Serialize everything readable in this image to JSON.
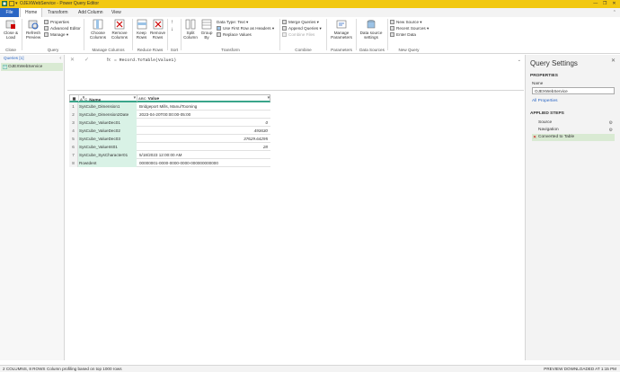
{
  "window": {
    "title": "OJEXWebService - Power Query Editor",
    "controls": [
      "—",
      "❐",
      "✕"
    ]
  },
  "tabs": [
    "File",
    "Home",
    "Transform",
    "Add Column",
    "View"
  ],
  "ribbon": {
    "close_load": "Close &\nLoad",
    "refresh_preview": "Refresh\nPreview",
    "properties": "Properties",
    "advanced_editor": "Advanced Editor",
    "manage": "Manage",
    "choose_columns": "Choose\nColumns",
    "remove_columns": "Remove\nColumns",
    "keep_rows": "Keep\nRows",
    "remove_rows": "Remove\nRows",
    "split_column": "Split\nColumn",
    "group_by": "Group\nBy",
    "data_type": "Data Type: Text",
    "use_first_row": "Use First Row as Headers",
    "replace_values": "Replace Values",
    "merge_queries": "Merge Queries",
    "append_queries": "Append Queries",
    "combine_files": "Combine Files",
    "manage_parameters": "Manage\nParameters",
    "data_source_settings": "Data source\nsettings",
    "new_source": "New Source",
    "recent_sources": "Recent Sources",
    "enter_data": "Enter Data",
    "groups": [
      "Close",
      "Query",
      "Manage Columns",
      "Reduce Rows",
      "Sort",
      "Transform",
      "Combine",
      "Parameters",
      "Data Sources",
      "New Query"
    ]
  },
  "queries": {
    "header": "Queries [1]",
    "items": [
      "OJEXWebService"
    ]
  },
  "formula": {
    "fx": "fx",
    "text": "= Record.ToTable(Value1)"
  },
  "table": {
    "columns": [
      "Name",
      "Value"
    ],
    "rows": [
      {
        "n": "1",
        "name": "SysCube_Dimension1",
        "value": "Bridgeport Mills, Manu/Tooming",
        "numeric": false
      },
      {
        "n": "2",
        "name": "SysCube_Dimension2Date",
        "value": "2023-04-20T00:00:00-05:00",
        "numeric": false
      },
      {
        "n": "3",
        "name": "SysCube_ValueDec01",
        "value": "0",
        "numeric": true
      },
      {
        "n": "4",
        "name": "SysCube_ValueDec02",
        "value": "493630",
        "numeric": true
      },
      {
        "n": "5",
        "name": "SysCube_ValueDec03",
        "value": "37629.64295",
        "numeric": true
      },
      {
        "n": "6",
        "name": "SysCube_ValueInt01",
        "value": "28",
        "numeric": true
      },
      {
        "n": "7",
        "name": "SysCube_SysCharacter01",
        "value": "5/18/2023 12:00:00 AM",
        "numeric": false
      },
      {
        "n": "8",
        "name": "RowIdent",
        "value": "00000001-0000-0000-0000-000000000000",
        "numeric": false
      }
    ]
  },
  "settings": {
    "title": "Query Settings",
    "properties_header": "PROPERTIES",
    "name_label": "Name",
    "name_value": "OJEXWebService",
    "all_properties": "All Properties",
    "applied_steps_header": "APPLIED STEPS",
    "steps": [
      "Source",
      "Navigation",
      "Converted to Table"
    ]
  },
  "status": {
    "left": "2 COLUMNS, 8 ROWS",
    "profiling": "Column profiling based on top 1000 rows",
    "right": "PREVIEW DOWNLOADED AT 1:15 PM"
  },
  "colors": {
    "accent": "#f2c811",
    "file_tab": "#2b66c4",
    "selection": "#d9ead3"
  }
}
